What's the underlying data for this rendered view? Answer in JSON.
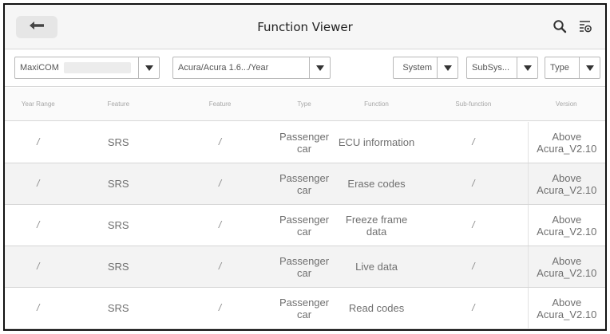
{
  "header": {
    "title": "Function Viewer",
    "back_icon": "arrow-left-icon",
    "search_icon": "search-icon",
    "filter_icon": "filter-list-icon"
  },
  "filters": {
    "product": "MaxiCOM",
    "vehicle": "Acura/Acura 1.6.../Year",
    "system": "System",
    "subsystem": "SubSys...",
    "type": "Type"
  },
  "table": {
    "columns": [
      "Year Range",
      "Feature",
      "Feature",
      "Type",
      "Function",
      "Sub-function",
      "Version"
    ],
    "rows": [
      {
        "year": "/",
        "feature1": "SRS",
        "feature2": "/",
        "type": "Passenger car",
        "function": "ECU information",
        "sub": "/",
        "version": "Above Acura_V2.10"
      },
      {
        "year": "/",
        "feature1": "SRS",
        "feature2": "/",
        "type": "Passenger car",
        "function": "Erase codes",
        "sub": "/",
        "version": "Above Acura_V2.10"
      },
      {
        "year": "/",
        "feature1": "SRS",
        "feature2": "/",
        "type": "Passenger car",
        "function": "Freeze frame data",
        "sub": "/",
        "version": "Above Acura_V2.10"
      },
      {
        "year": "/",
        "feature1": "SRS",
        "feature2": "/",
        "type": "Passenger car",
        "function": "Live data",
        "sub": "/",
        "version": "Above Acura_V2.10"
      },
      {
        "year": "/",
        "feature1": "SRS",
        "feature2": "/",
        "type": "Passenger car",
        "function": "Read codes",
        "sub": "/",
        "version": "Above Acura_V2.10"
      }
    ]
  }
}
